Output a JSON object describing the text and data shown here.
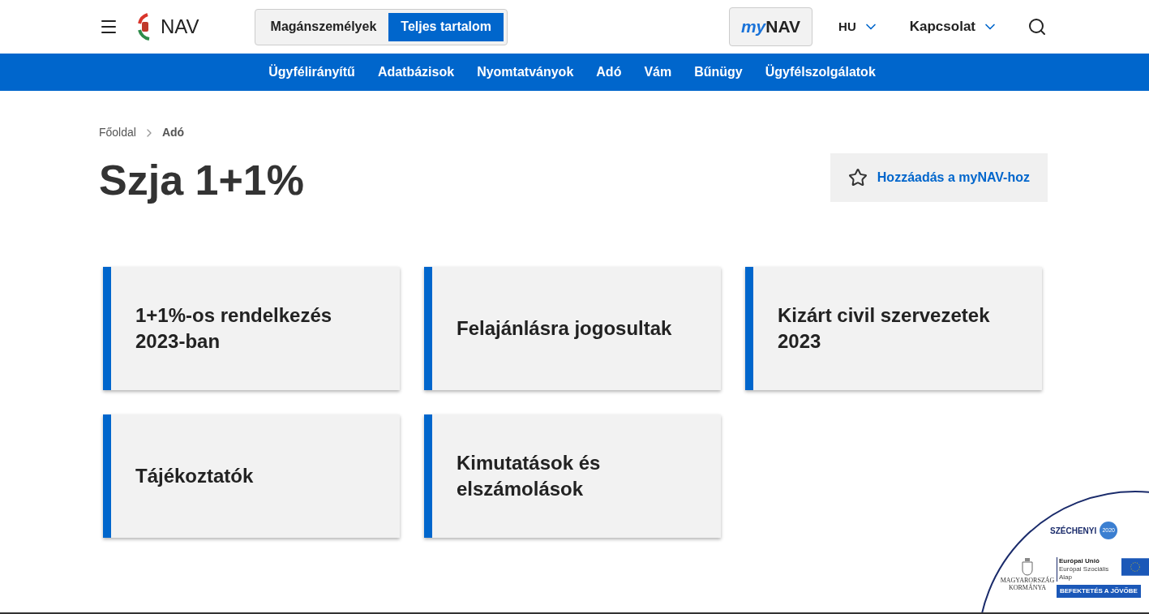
{
  "header": {
    "logo_text": "NAV",
    "audience_tabs": [
      {
        "label": "Magánszemélyek",
        "selected": false
      },
      {
        "label": "Teljes tartalom",
        "selected": true
      }
    ],
    "mynav": {
      "prefix": "my",
      "main": "NAV"
    },
    "language": "HU",
    "contact": "Kapcsolat"
  },
  "nav": [
    "Ügyfélirányítű",
    "Adatbázisok",
    "Nyomtatványok",
    "Adó",
    "Vám",
    "Bűnügy",
    "Ügyfélszolgálatok"
  ],
  "breadcrumb": [
    "Főoldal",
    "Adó"
  ],
  "title": "Szja 1+1%",
  "add_button": "Hozzáadás a myNAV-hoz",
  "cards": [
    "1+1%-os rendelkezés 2023-ban",
    "Felajánlásra jogosultak",
    "Kizárt civil szervezetek 2023",
    "Tájékoztatók",
    "Kimutatások és elszámolások"
  ],
  "badge": {
    "program": "SZÉCHENYI",
    "year": "2020",
    "eu_title": "Európai Unió",
    "eu_fund": "Európai Szociális Alap",
    "gov": "MAGYARORSZÁG KORMÁNYA",
    "slogan": "BEFEKTETÉS A JÖVŐBE"
  }
}
